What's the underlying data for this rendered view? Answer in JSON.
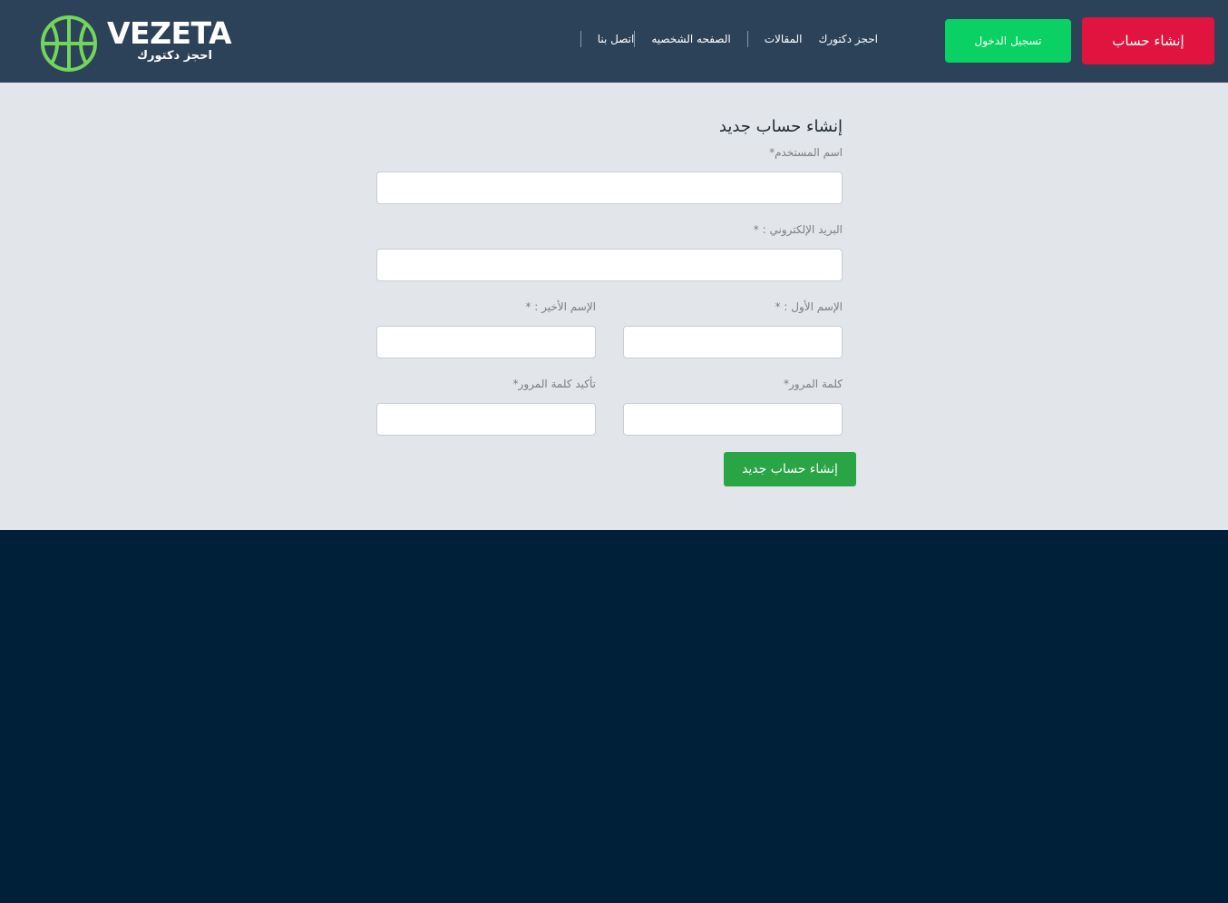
{
  "header": {
    "logo_text": "VEZETA",
    "logo_subtitle": "احجز دكتورك",
    "nav": [
      {
        "label": "اتصل بنا"
      },
      {
        "label": "الصفحه الشخصيه"
      },
      {
        "label": "المقالات"
      },
      {
        "label": "احجز دكتورك"
      }
    ],
    "login_label": "تسجيل الدخول",
    "register_label": "إنشاء حساب"
  },
  "form": {
    "title": "إنشاء حساب جديد",
    "username_label": "اسم المستخدم*",
    "username_value": "",
    "email_label": "البريد الإلكتروني : *",
    "email_value": "",
    "first_name_label": "الإسم الأول : *",
    "first_name_value": "",
    "last_name_label": "الإسم الأخير : *",
    "last_name_value": "",
    "password_label": "كلمة المرور*",
    "password_value": "",
    "confirm_password_label": "تأكيد كلمة المرور*",
    "confirm_password_value": "",
    "submit_label": "إنشاء حساب جديد"
  },
  "colors": {
    "header_bg": "#2c4259",
    "content_bg": "#e2e6ea",
    "footer_bg": "#001f38",
    "login_button": "#0ad163",
    "register_button": "#e0143e",
    "submit_button": "#29a545",
    "logo_accent": "#72d65a"
  },
  "icons": {
    "logo": "basketball-icon"
  }
}
